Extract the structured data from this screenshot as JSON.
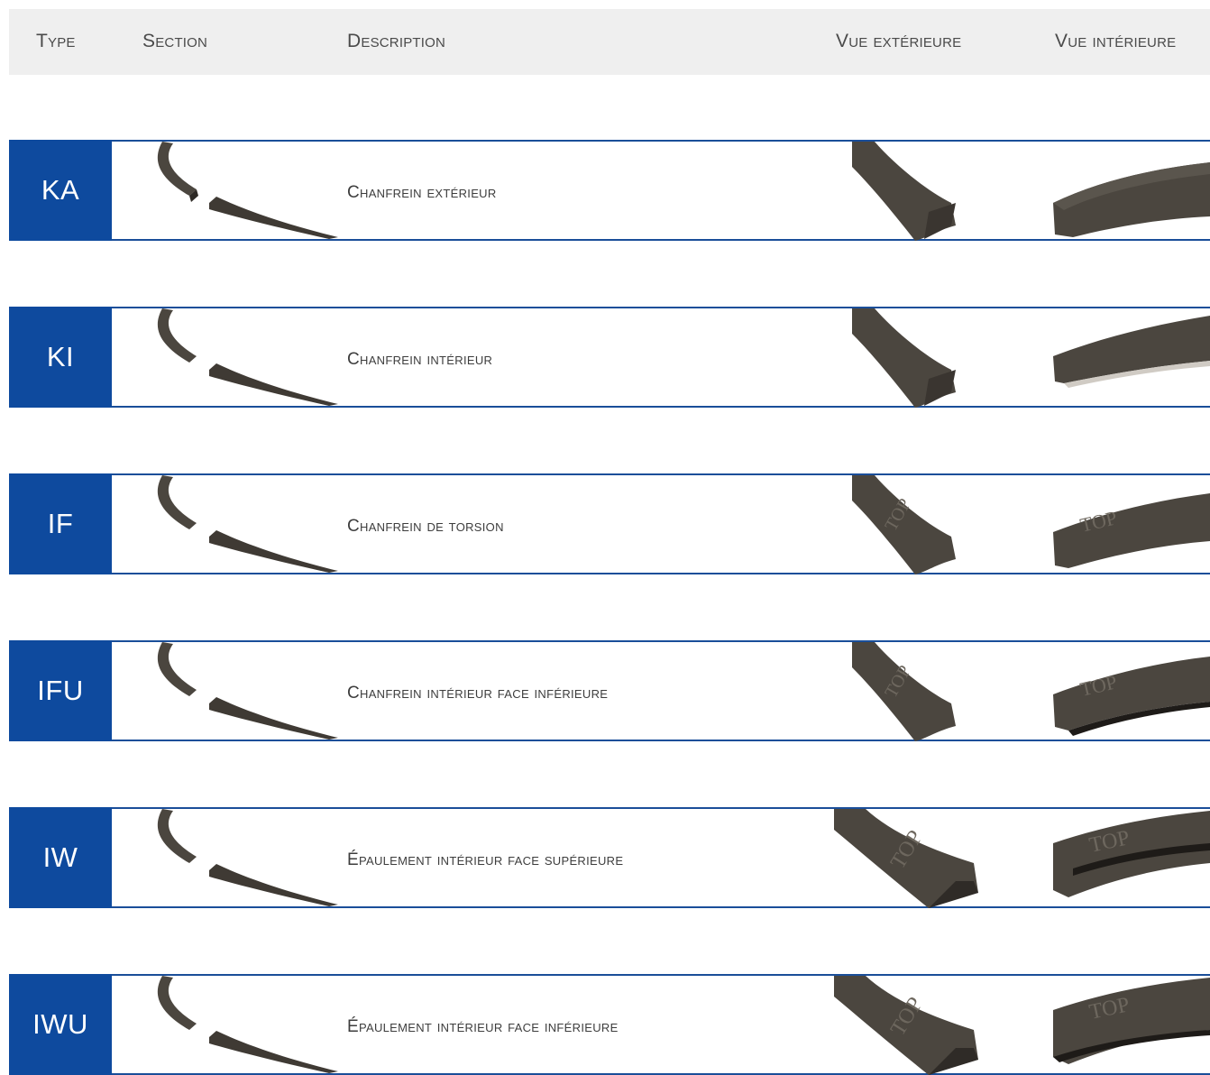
{
  "header": {
    "type": "Type",
    "section": "Section",
    "description": "Description",
    "vue_exterieure": "Vue extérieure",
    "vue_interieure": "Vue intérieure"
  },
  "rows": [
    {
      "type": "KA",
      "description": "Chanfrein extérieur"
    },
    {
      "type": "KI",
      "description": "Chanfrein intérieur"
    },
    {
      "type": "IF",
      "description": "Chanfrein de torsion"
    },
    {
      "type": "IFU",
      "description": "Chanfrein intérieur face inférieure"
    },
    {
      "type": "IW",
      "description": "Épaulement intérieur face supérieure"
    },
    {
      "type": "IWU",
      "description": "Épaulement intérieur face inférieure"
    }
  ],
  "colors": {
    "accent": "#0e4a9e",
    "rule": "#1a4e99",
    "header_bg": "#efefef",
    "ring": "#4b463f"
  },
  "images": {
    "section": "piston-ring-section-image",
    "exterior": "piston-ring-exterior-view-image",
    "interior": "piston-ring-interior-view-image",
    "engraving": "TOP"
  }
}
